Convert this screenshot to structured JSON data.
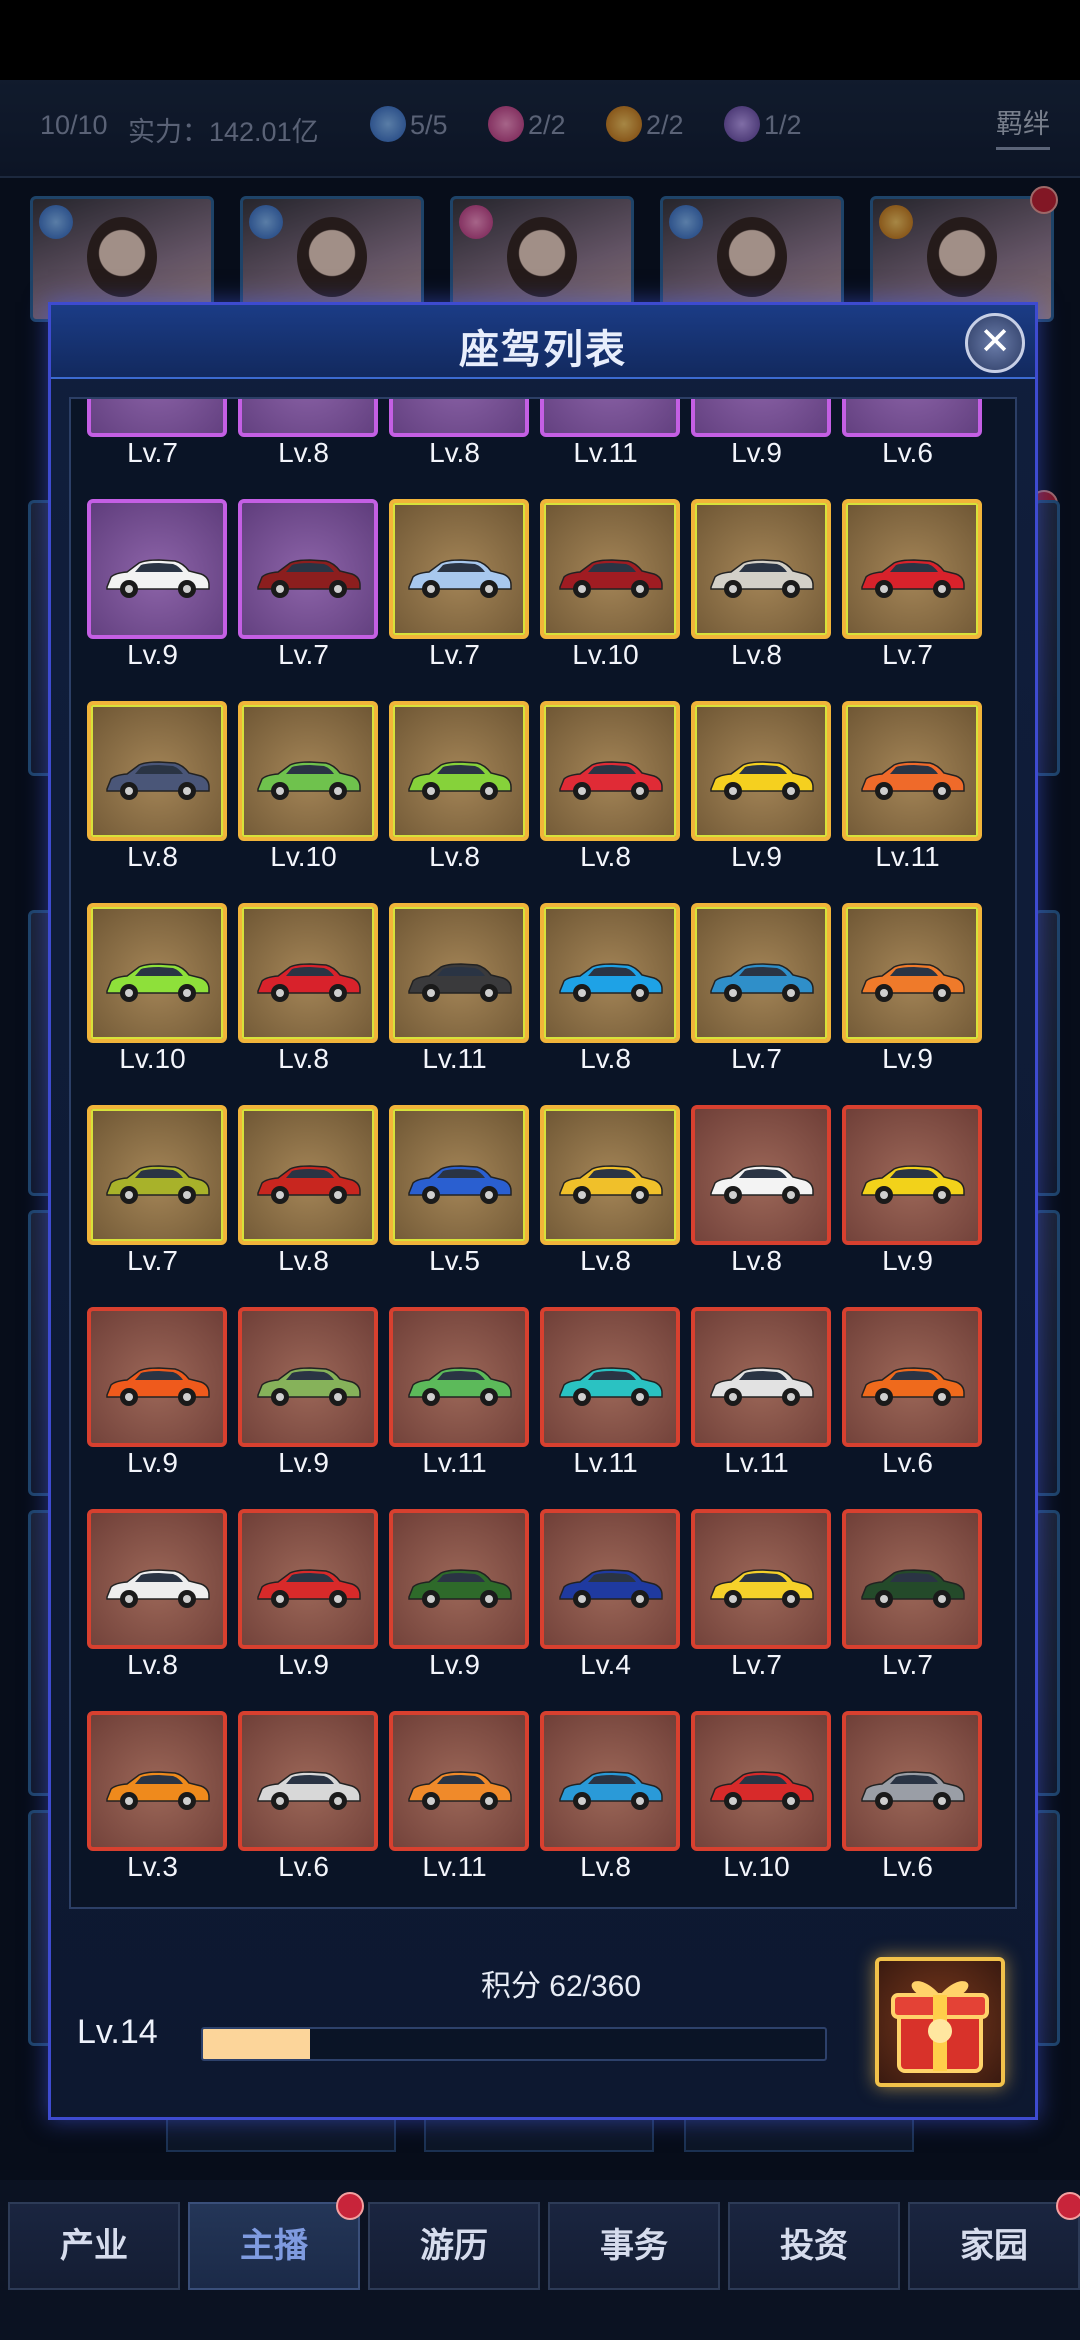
{
  "header": {
    "count": "10/10",
    "power": "实力：142.01亿",
    "badges": [
      {
        "value": "5/5",
        "color": "#4c8fe6",
        "icon": "blue-flower-icon"
      },
      {
        "value": "2/2",
        "color": "#d64f9e",
        "icon": "pink-flower-icon"
      },
      {
        "value": "2/2",
        "color": "#e08f1c",
        "icon": "orange-flower-icon"
      },
      {
        "value": "1/2",
        "color": "#8d6fc7",
        "icon": "purple-flower-icon"
      }
    ],
    "bond_label": "羁绊"
  },
  "modal": {
    "title": "座驾列表",
    "close_icon": "close-icon",
    "score_label": "积分 62/360",
    "level_label": "Lv.14",
    "progress": 0.172,
    "gift_icon": "gift-box-icon",
    "cars": [
      {
        "level": "Lv.7",
        "rarity": "purple",
        "color": "#8a5fb0"
      },
      {
        "level": "Lv.8",
        "rarity": "purple",
        "color": "#8a5fb0"
      },
      {
        "level": "Lv.8",
        "rarity": "purple",
        "color": "#8a5fb0"
      },
      {
        "level": "Lv.11",
        "rarity": "purple",
        "color": "#8a5fb0"
      },
      {
        "level": "Lv.9",
        "rarity": "purple",
        "color": "#8a5fb0"
      },
      {
        "level": "Lv.6",
        "rarity": "purple",
        "color": "#8a5fb0"
      },
      {
        "level": "Lv.9",
        "rarity": "purple",
        "color": "#f2f2f2"
      },
      {
        "level": "Lv.7",
        "rarity": "purple",
        "color": "#8c1e1e"
      },
      {
        "level": "Lv.7",
        "rarity": "gold",
        "color": "#a8c8ee"
      },
      {
        "level": "Lv.10",
        "rarity": "gold",
        "color": "#a01c22"
      },
      {
        "level": "Lv.8",
        "rarity": "gold",
        "color": "#d3d0c8"
      },
      {
        "level": "Lv.7",
        "rarity": "gold",
        "color": "#d8222b"
      },
      {
        "level": "Lv.8",
        "rarity": "gold",
        "color": "#4a5678"
      },
      {
        "level": "Lv.10",
        "rarity": "gold",
        "color": "#6fc24d"
      },
      {
        "level": "Lv.8",
        "rarity": "gold",
        "color": "#86d23a"
      },
      {
        "level": "Lv.8",
        "rarity": "gold",
        "color": "#e02b36"
      },
      {
        "level": "Lv.9",
        "rarity": "gold",
        "color": "#f5d01f"
      },
      {
        "level": "Lv.11",
        "rarity": "gold",
        "color": "#ef6a2a"
      },
      {
        "level": "Lv.10",
        "rarity": "gold",
        "color": "#8ee03a"
      },
      {
        "level": "Lv.8",
        "rarity": "gold",
        "color": "#d8222b"
      },
      {
        "level": "Lv.11",
        "rarity": "gold",
        "color": "#3a3a3c"
      },
      {
        "level": "Lv.8",
        "rarity": "gold",
        "color": "#1ea2e6"
      },
      {
        "level": "Lv.7",
        "rarity": "gold",
        "color": "#2f8fc9"
      },
      {
        "level": "Lv.9",
        "rarity": "gold",
        "color": "#ef7a2a"
      },
      {
        "level": "Lv.7",
        "rarity": "gold",
        "color": "#a8b22a"
      },
      {
        "level": "Lv.8",
        "rarity": "gold",
        "color": "#c8261f"
      },
      {
        "level": "Lv.5",
        "rarity": "gold",
        "color": "#2a5fd0"
      },
      {
        "level": "Lv.8",
        "rarity": "gold",
        "color": "#f0c02a"
      },
      {
        "level": "Lv.8",
        "rarity": "red",
        "color": "#f3f3f3"
      },
      {
        "level": "Lv.9",
        "rarity": "red",
        "color": "#f2d21a"
      },
      {
        "level": "Lv.9",
        "rarity": "red",
        "color": "#ef5a1c"
      },
      {
        "level": "Lv.9",
        "rarity": "red",
        "color": "#86b25a"
      },
      {
        "level": "Lv.11",
        "rarity": "red",
        "color": "#5cba5a"
      },
      {
        "level": "Lv.11",
        "rarity": "red",
        "color": "#2ac2c2"
      },
      {
        "level": "Lv.11",
        "rarity": "red",
        "color": "#e2e2e2"
      },
      {
        "level": "Lv.6",
        "rarity": "red",
        "color": "#ef6a1c"
      },
      {
        "level": "Lv.8",
        "rarity": "red",
        "color": "#eeeeee"
      },
      {
        "level": "Lv.9",
        "rarity": "red",
        "color": "#d82a2a"
      },
      {
        "level": "Lv.9",
        "rarity": "red",
        "color": "#2e6a2a"
      },
      {
        "level": "Lv.4",
        "rarity": "red",
        "color": "#1f3aa0"
      },
      {
        "level": "Lv.7",
        "rarity": "red",
        "color": "#f5d12a"
      },
      {
        "level": "Lv.7",
        "rarity": "red",
        "color": "#244a2a"
      },
      {
        "level": "Lv.3",
        "rarity": "red",
        "color": "#ef8a1c"
      },
      {
        "level": "Lv.6",
        "rarity": "red",
        "color": "#d8d8d8"
      },
      {
        "level": "Lv.11",
        "rarity": "red",
        "color": "#f08a2a"
      },
      {
        "level": "Lv.8",
        "rarity": "red",
        "color": "#2a9ad8"
      },
      {
        "level": "Lv.10",
        "rarity": "red",
        "color": "#d82a2a"
      },
      {
        "level": "Lv.6",
        "rarity": "red",
        "color": "#9a9ea6"
      }
    ]
  },
  "nav": {
    "tabs": [
      {
        "label": "产业",
        "active": false,
        "badge": false
      },
      {
        "label": "主播",
        "active": true,
        "badge": true
      },
      {
        "label": "游历",
        "active": false,
        "badge": false
      },
      {
        "label": "事务",
        "active": false,
        "badge": false
      },
      {
        "label": "投资",
        "active": false,
        "badge": false
      },
      {
        "label": "家园",
        "active": false,
        "badge": true
      }
    ]
  }
}
